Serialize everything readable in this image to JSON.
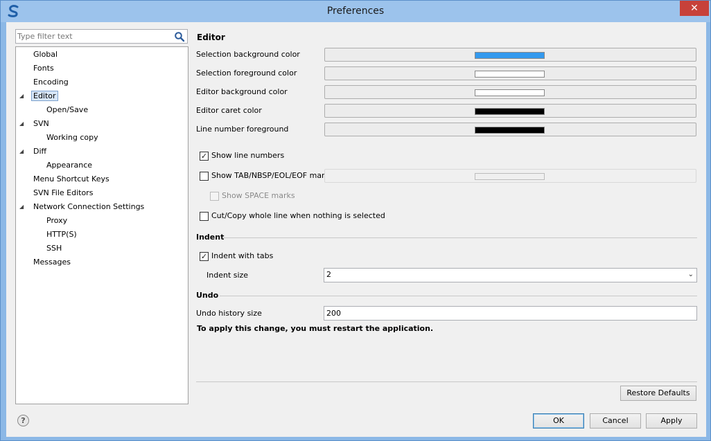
{
  "window": {
    "title": "Preferences",
    "close_label": "✕"
  },
  "filter": {
    "placeholder": "Type filter text"
  },
  "tree": {
    "items": [
      {
        "label": "Global",
        "level": 0,
        "expandable": false
      },
      {
        "label": "Fonts",
        "level": 0,
        "expandable": false
      },
      {
        "label": "Encoding",
        "level": 0,
        "expandable": false
      },
      {
        "label": "Editor",
        "level": 0,
        "expandable": true,
        "selected": true
      },
      {
        "label": "Open/Save",
        "level": 1,
        "expandable": false
      },
      {
        "label": "SVN",
        "level": 0,
        "expandable": true
      },
      {
        "label": "Working copy",
        "level": 1,
        "expandable": false
      },
      {
        "label": "Diff",
        "level": 0,
        "expandable": true
      },
      {
        "label": "Appearance",
        "level": 1,
        "expandable": false
      },
      {
        "label": "Menu Shortcut Keys",
        "level": 0,
        "expandable": false
      },
      {
        "label": "SVN File Editors",
        "level": 0,
        "expandable": false
      },
      {
        "label": "Network Connection Settings",
        "level": 0,
        "expandable": true
      },
      {
        "label": "Proxy",
        "level": 1,
        "expandable": false
      },
      {
        "label": "HTTP(S)",
        "level": 1,
        "expandable": false
      },
      {
        "label": "SSH",
        "level": 1,
        "expandable": false
      },
      {
        "label": "Messages",
        "level": 0,
        "expandable": false
      }
    ]
  },
  "editor": {
    "title": "Editor",
    "colors": [
      {
        "label": "Selection background color",
        "color": "#3399ee"
      },
      {
        "label": "Selection foreground color",
        "color": "#ffffff"
      },
      {
        "label": "Editor background color",
        "color": "#ffffff"
      },
      {
        "label": "Editor caret color",
        "color": "#000000"
      },
      {
        "label": "Line number foreground",
        "color": "#000000"
      }
    ],
    "show_line_numbers": {
      "label": "Show line numbers",
      "checked": true
    },
    "show_marks": {
      "label": "Show TAB/NBSP/EOL/EOF marks",
      "checked": false
    },
    "show_space": {
      "label": "Show SPACE marks",
      "checked": false
    },
    "cut_copy": {
      "label": "Cut/Copy whole line when nothing is selected",
      "checked": false
    }
  },
  "indent": {
    "title": "Indent",
    "with_tabs": {
      "label": "Indent with tabs",
      "checked": true
    },
    "size_label": "Indent size",
    "size_value": "2"
  },
  "undo": {
    "title": "Undo",
    "history_label": "Undo history size",
    "history_value": "200",
    "notice": "To apply this change, you must restart the application."
  },
  "buttons": {
    "restore": "Restore Defaults",
    "ok": "OK",
    "cancel": "Cancel",
    "apply": "Apply",
    "help": "?"
  }
}
